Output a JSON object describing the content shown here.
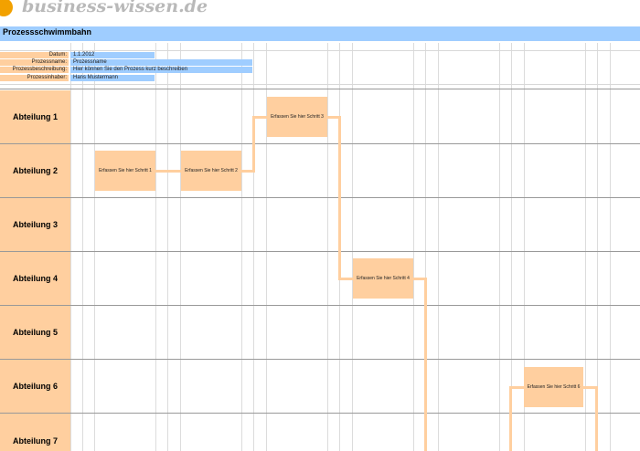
{
  "logo": {
    "text": "business-wissen.de"
  },
  "title": "Prozessschwimmbahn",
  "info": [
    {
      "label": "Datum:",
      "value": "1.1.2012"
    },
    {
      "label": "Prozessname:",
      "value": "Prozessname"
    },
    {
      "label": "Prozessbeschreibung:",
      "value": "Hier können Sie den Prozess kurz beschreiben"
    },
    {
      "label": "Prozessinhaber:",
      "value": "Hans Mustermann"
    }
  ],
  "lanes": [
    "Abteilung 1",
    "Abteilung 2",
    "Abteilung 3",
    "Abteilung 4",
    "Abteilung 5",
    "Abteilung 6",
    "Abteilung 7"
  ],
  "steps": [
    "Erfassen Sie hier Schritt 1",
    "Erfassen Sie hier Schritt 2",
    "Erfassen Sie hier Schritt 3",
    "Erfassen Sie hier Schritt 4",
    "Erfassen Sie hier Schritt 6"
  ],
  "colors": {
    "accent_blue": "#9fcdff",
    "accent_orange": "#ffcf9f",
    "logo_dot": "#f2a100",
    "logo_text": "#b9b9b9"
  }
}
